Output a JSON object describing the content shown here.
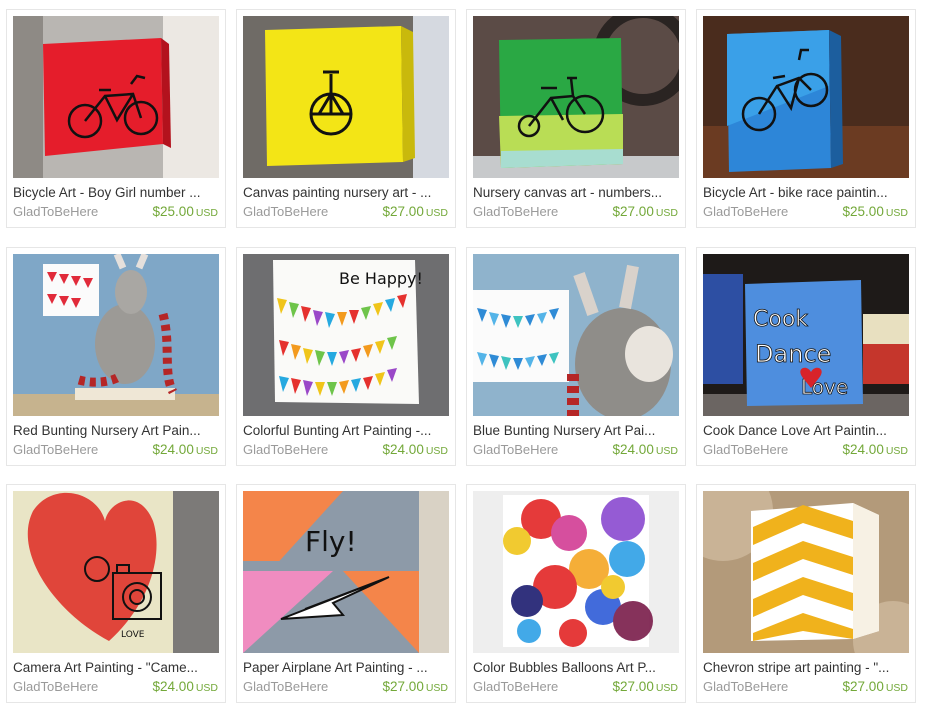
{
  "listings": [
    {
      "title": "Bicycle Art - Boy Girl number ...",
      "shop": "GladToBeHere",
      "price": "$25.00",
      "currency": "USD",
      "image": "red-canvas-bicycle"
    },
    {
      "title": "Canvas painting nursery art - ...",
      "shop": "GladToBeHere",
      "price": "$27.00",
      "currency": "USD",
      "image": "yellow-canvas-unicycle"
    },
    {
      "title": "Nursery canvas art - numbers...",
      "shop": "GladToBeHere",
      "price": "$27.00",
      "currency": "USD",
      "image": "green-canvas-tricycle"
    },
    {
      "title": "Bicycle Art - bike race paintin...",
      "shop": "GladToBeHere",
      "price": "$25.00",
      "currency": "USD",
      "image": "blue-canvas-bicycle"
    },
    {
      "title": "Red Bunting Nursery Art Pain...",
      "shop": "GladToBeHere",
      "price": "$24.00",
      "currency": "USD",
      "image": "red-bunting-donkey"
    },
    {
      "title": "Colorful Bunting Art Painting -...",
      "shop": "GladToBeHere",
      "price": "$24.00",
      "currency": "USD",
      "image": "colorful-bunting-be-happy"
    },
    {
      "title": "Blue Bunting Nursery Art Pai...",
      "shop": "GladToBeHere",
      "price": "$24.00",
      "currency": "USD",
      "image": "blue-bunting-donkey"
    },
    {
      "title": "Cook Dance Love Art Paintin...",
      "shop": "GladToBeHere",
      "price": "$24.00",
      "currency": "USD",
      "image": "cook-dance-love"
    },
    {
      "title": "Camera Art Painting - \"Came...",
      "shop": "GladToBeHere",
      "price": "$24.00",
      "currency": "USD",
      "image": "camera-heart"
    },
    {
      "title": "Paper Airplane Art Painting - ...",
      "shop": "GladToBeHere",
      "price": "$27.00",
      "currency": "USD",
      "image": "paper-airplane-fly"
    },
    {
      "title": "Color Bubbles Balloons Art P...",
      "shop": "GladToBeHere",
      "price": "$27.00",
      "currency": "USD",
      "image": "color-bubbles"
    },
    {
      "title": "Chevron stripe art painting - \"...",
      "shop": "GladToBeHere",
      "price": "$27.00",
      "currency": "USD",
      "image": "yellow-chevron"
    }
  ],
  "image_text": {
    "be_happy": "Be Happy!",
    "cook": "Cook",
    "dance": "Dance",
    "love": "Love",
    "love_small": "LOVE",
    "fly": "Fly!"
  },
  "colors": {
    "price": "#73a839",
    "shop": "#9a9a9a",
    "title": "#333333",
    "border": "#e6e6e6"
  }
}
